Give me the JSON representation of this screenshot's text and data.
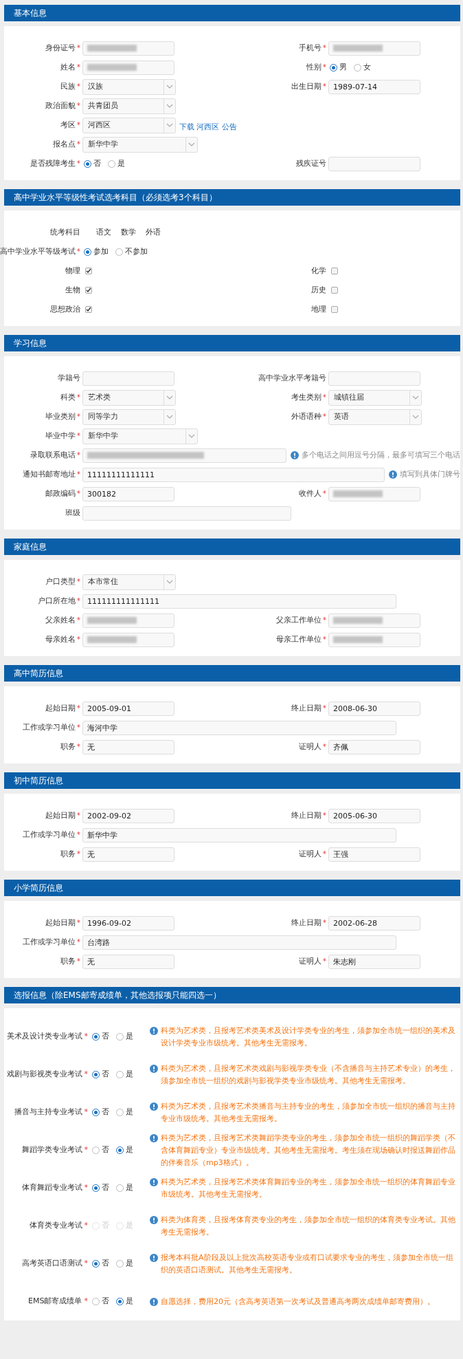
{
  "sections": [
    {
      "title": "基本信息",
      "rows": [
        [
          {
            "label": "身份证号",
            "mark": "*",
            "kind": "text",
            "blurred": true
          },
          {
            "label": "手机号",
            "mark": "*",
            "kind": "text",
            "blurred": true
          }
        ],
        [
          {
            "label": "姓名",
            "mark": "*",
            "kind": "text",
            "blurred": true
          },
          {
            "label": "性别",
            "mark": "*",
            "kind": "radio",
            "options": [
              {
                "label": "男",
                "selected": true,
                "disabled": false
              },
              {
                "label": "女",
                "selected": false,
                "disabled": false
              }
            ]
          }
        ],
        [
          {
            "label": "民族",
            "mark": "*",
            "kind": "select",
            "value": "汉族"
          },
          {
            "label": "出生日期",
            "mark": "*",
            "kind": "text",
            "value": "1989-07-14"
          }
        ],
        [
          {
            "label": "政治面貌",
            "mark": "*",
            "kind": "select",
            "value": "共青团员"
          }
        ],
        [
          {
            "label": "考区",
            "mark": "*",
            "kind": "select",
            "value": "河西区",
            "link": "下载 河西区 公告"
          }
        ],
        [
          {
            "label": "报名点",
            "mark": "*",
            "kind": "select-wide",
            "value": "新华中学"
          }
        ],
        [
          {
            "label": "是否残障考生",
            "mark": "*",
            "kind": "radio",
            "options": [
              {
                "label": "否",
                "selected": true,
                "disabled": false
              },
              {
                "label": "是",
                "selected": false,
                "disabled": false
              }
            ]
          },
          {
            "label": "残疾证号",
            "kind": "text"
          }
        ]
      ]
    },
    {
      "title": "高中学业水平等级性考试选考科目（必须选考3个科目）",
      "rows": [
        [
          {
            "label": "统考科目",
            "kind": "static",
            "values": [
              "语文",
              "数学",
              "外语"
            ]
          }
        ],
        [
          {
            "label": "高中学业水平等级考试",
            "mark": "*",
            "kind": "radio",
            "options": [
              {
                "label": "参加",
                "selected": true,
                "disabled": false
              },
              {
                "label": "不参加",
                "selected": false,
                "disabled": false
              }
            ]
          }
        ],
        [
          {
            "label": "物理",
            "kind": "checkbox",
            "checked": true
          },
          {
            "label": "化学",
            "kind": "checkbox",
            "checked": false
          }
        ],
        [
          {
            "label": "生物",
            "kind": "checkbox",
            "checked": true
          },
          {
            "label": "历史",
            "kind": "checkbox",
            "checked": false
          }
        ],
        [
          {
            "label": "思想政治",
            "kind": "checkbox",
            "checked": true
          },
          {
            "label": "地理",
            "kind": "checkbox",
            "checked": false
          }
        ]
      ]
    },
    {
      "title": "学习信息",
      "rows": [
        [
          {
            "label": "学籍号",
            "kind": "text"
          },
          {
            "label": "高中学业水平考籍号",
            "kind": "text"
          }
        ],
        [
          {
            "label": "科类",
            "mark": "*",
            "kind": "select",
            "value": "艺术类"
          },
          {
            "label": "考生类别",
            "mark": "*",
            "kind": "select",
            "value": "城镇往届"
          }
        ],
        [
          {
            "label": "毕业类别",
            "mark": "*",
            "kind": "select",
            "value": "同等学力"
          },
          {
            "label": "外语语种",
            "mark": "*",
            "kind": "select",
            "value": "英语"
          }
        ],
        [
          {
            "label": "毕业中学",
            "mark": "*",
            "kind": "select-wide",
            "value": "新华中学"
          }
        ],
        [
          {
            "label": "录取联系电话",
            "mark": "*",
            "kind": "text-medium",
            "blurred": true,
            "hint": "多个电话之间用逗号分隔，最多可填写三个电话"
          }
        ],
        [
          {
            "label": "通知书邮寄地址",
            "mark": "*",
            "kind": "text-long",
            "value": "11111111111111",
            "hint": "填写到具体门牌号"
          }
        ],
        [
          {
            "label": "邮政编码",
            "mark": "*",
            "kind": "text",
            "value": "300182"
          },
          {
            "label": "收件人",
            "mark": "*",
            "kind": "text",
            "blurred": true
          }
        ],
        [
          {
            "label": "班级",
            "kind": "text-medium"
          }
        ]
      ]
    },
    {
      "title": "家庭信息",
      "rows": [
        [
          {
            "label": "户口类型",
            "mark": "*",
            "kind": "select",
            "value": "本市常住"
          }
        ],
        [
          {
            "label": "户口所在地",
            "mark": "*",
            "kind": "text-long",
            "value": "111111111111111"
          }
        ],
        [
          {
            "label": "父亲姓名",
            "mark": "*",
            "kind": "text",
            "blurred": true
          },
          {
            "label": "父亲工作单位",
            "mark": "*",
            "kind": "text",
            "blurred": true
          }
        ],
        [
          {
            "label": "母亲姓名",
            "mark": "*",
            "kind": "text",
            "blurred": true
          },
          {
            "label": "母亲工作单位",
            "mark": "*",
            "kind": "text",
            "blurred": true
          }
        ]
      ]
    },
    {
      "title": "高中简历信息",
      "rows": [
        [
          {
            "label": "起始日期",
            "mark": "*",
            "kind": "text",
            "value": "2005-09-01"
          },
          {
            "label": "终止日期",
            "mark": "*",
            "kind": "text",
            "value": "2008-06-30"
          }
        ],
        [
          {
            "label": "工作或学习单位",
            "mark": "*",
            "kind": "text-long",
            "value": "海河中学"
          }
        ],
        [
          {
            "label": "职务",
            "mark": "*",
            "kind": "text",
            "value": "无"
          },
          {
            "label": "证明人",
            "mark": "*",
            "kind": "text",
            "value": "齐佩"
          }
        ]
      ]
    },
    {
      "title": "初中简历信息",
      "rows": [
        [
          {
            "label": "起始日期",
            "mark": "*",
            "kind": "text",
            "value": "2002-09-02"
          },
          {
            "label": "终止日期",
            "mark": "*",
            "kind": "text",
            "value": "2005-06-30"
          }
        ],
        [
          {
            "label": "工作或学习单位",
            "mark": "*",
            "kind": "text-long",
            "value": "新华中学"
          }
        ],
        [
          {
            "label": "职务",
            "mark": "*",
            "kind": "text",
            "value": "无"
          },
          {
            "label": "证明人",
            "mark": "*",
            "kind": "text",
            "value": "王强"
          }
        ]
      ]
    },
    {
      "title": "小学简历信息",
      "rows": [
        [
          {
            "label": "起始日期",
            "mark": "*",
            "kind": "text",
            "value": "1996-09-02"
          },
          {
            "label": "终止日期",
            "mark": "*",
            "kind": "text",
            "value": "2002-06-28"
          }
        ],
        [
          {
            "label": "工作或学习单位",
            "mark": "*",
            "kind": "text-long",
            "value": "台湾路"
          }
        ],
        [
          {
            "label": "职务",
            "mark": "*",
            "kind": "text",
            "value": "无"
          },
          {
            "label": "证明人",
            "mark": "*",
            "kind": "text",
            "value": "朱志刚"
          }
        ]
      ]
    },
    {
      "title": "选报信息（除EMS邮寄成绩单，其他选报项只能四选一）",
      "options_list": [
        {
          "label": "美术及设计类专业考试",
          "mark": "*",
          "options": [
            {
              "label": "否",
              "selected": true,
              "disabled": false
            },
            {
              "label": "是",
              "selected": false,
              "disabled": false
            }
          ],
          "note": "科类为艺术类，且报考艺术类美术及设计学类专业的考生，须参加全市统一组织的美术及设计学类专业市级统考。其他考生无需报考。"
        },
        {
          "label": "戏剧与影视类专业考试",
          "mark": "*",
          "options": [
            {
              "label": "否",
              "selected": true,
              "disabled": false
            },
            {
              "label": "是",
              "selected": false,
              "disabled": false
            }
          ],
          "note": "科类为艺术类，且报考艺术类戏剧与影视学类专业（不含播音与主持艺术专业）的考生，须参加全市统一组织的戏剧与影视学类专业市级统考。其他考生无需报考。"
        },
        {
          "label": "播音与主持专业考试",
          "mark": "*",
          "options": [
            {
              "label": "否",
              "selected": true,
              "disabled": false
            },
            {
              "label": "是",
              "selected": false,
              "disabled": false
            }
          ],
          "note": "科类为艺术类，且报考艺术类播音与主持专业的考生，须参加全市统一组织的播音与主持专业市级统考。其他考生无需报考。"
        },
        {
          "label": "舞蹈学类专业考试",
          "mark": "*",
          "options": [
            {
              "label": "否",
              "selected": false,
              "disabled": false
            },
            {
              "label": "是",
              "selected": true,
              "disabled": false
            }
          ],
          "note": "科类为艺术类，且报考艺术类舞蹈学类专业的考生，须参加全市统一组织的舞蹈学类（不含体育舞蹈专业）专业市级统考。其他考生无需报考。考生须在现场确认时报送舞蹈作品的伴奏音乐（mp3格式）。"
        },
        {
          "label": "体育舞蹈专业考试",
          "mark": "*",
          "options": [
            {
              "label": "否",
              "selected": true,
              "disabled": false
            },
            {
              "label": "是",
              "selected": false,
              "disabled": false
            }
          ],
          "note": "科类为艺术类，且报考艺术类体育舞蹈专业的考生，须参加全市统一组织的体育舞蹈专业市级统考。其他考生无需报考。"
        },
        {
          "label": "体育类专业考试",
          "mark": "*",
          "options": [
            {
              "label": "否",
              "selected": false,
              "disabled": true
            },
            {
              "label": "是",
              "selected": false,
              "disabled": true
            }
          ],
          "note": "科类为体育类，且报考体育类专业的考生，须参加全市统一组织的体育类专业考试。其他考生无需报考。"
        },
        {
          "label": "高考英语口语测试",
          "mark": "*",
          "options": [
            {
              "label": "否",
              "selected": true,
              "disabled": false
            },
            {
              "label": "是",
              "selected": false,
              "disabled": false
            }
          ],
          "note": "报考本科批A阶段及以上批次高校英语专业或有口试要求专业的考生，须参加全市统一组织的英语口语测试。其他考生无需报考。"
        },
        {
          "label": "EMS邮寄成绩单",
          "mark": "*",
          "options": [
            {
              "label": "否",
              "selected": false,
              "disabled": false
            },
            {
              "label": "是",
              "selected": true,
              "disabled": false
            }
          ],
          "note": "自愿选择，费用20元（含高考英语第一次考试及普通高考两次成绩单邮寄费用）。"
        }
      ]
    }
  ]
}
